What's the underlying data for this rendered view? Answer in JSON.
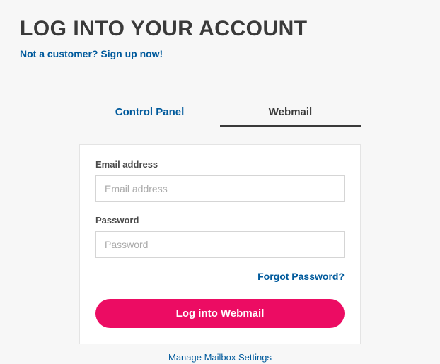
{
  "header": {
    "title": "LOG INTO YOUR ACCOUNT",
    "signup_link": "Not a customer? Sign up now!"
  },
  "tabs": {
    "control_panel": "Control Panel",
    "webmail": "Webmail"
  },
  "form": {
    "email_label": "Email address",
    "email_placeholder": "Email address",
    "password_label": "Password",
    "password_placeholder": "Password",
    "forgot_password": "Forgot Password?",
    "login_button": "Log into Webmail"
  },
  "footer": {
    "manage_link": "Manage Mailbox Settings"
  }
}
